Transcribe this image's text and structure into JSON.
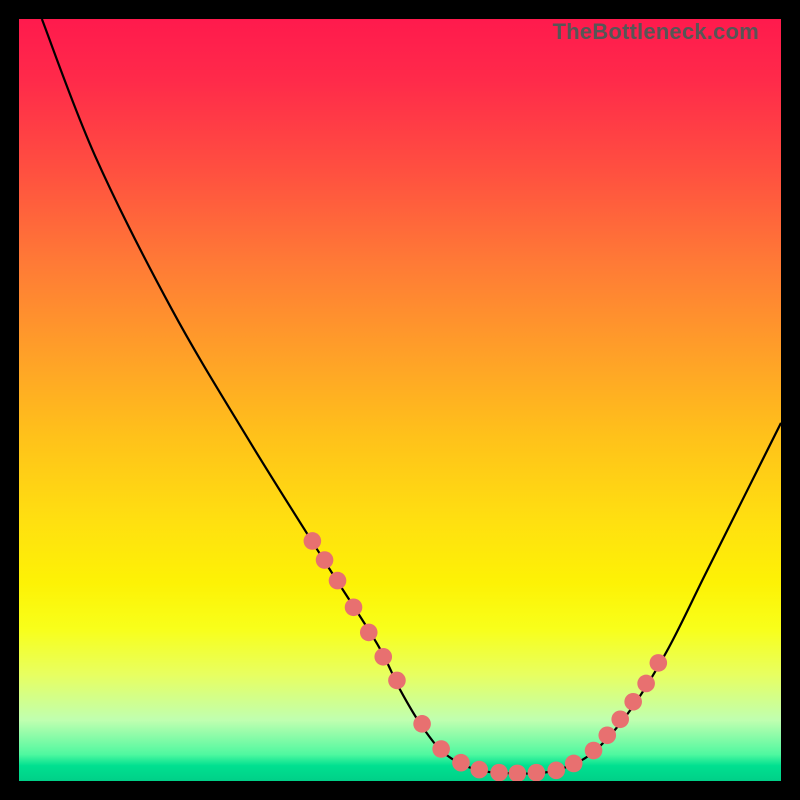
{
  "attribution": "TheBottleneck.com",
  "colors": {
    "background": "#000000",
    "gradient_top": "#ff1a4d",
    "gradient_bottom": "#00d088",
    "curve": "#000000",
    "dots": "#e87070"
  },
  "chart_data": {
    "type": "line",
    "title": "",
    "xlabel": "",
    "ylabel": "",
    "xlim": [
      0,
      100
    ],
    "ylim": [
      0,
      100
    ],
    "series": [
      {
        "name": "curve",
        "x": [
          3,
          10,
          20,
          30,
          40,
          47,
          50,
          53,
          56,
          60,
          65,
          70,
          75,
          80,
          85,
          90,
          95,
          100
        ],
        "y": [
          100,
          82,
          62,
          45,
          29,
          18,
          12,
          7,
          3.5,
          1.5,
          1,
          1.3,
          3.5,
          9,
          17,
          27,
          37,
          47
        ]
      }
    ],
    "marker_points": {
      "left_segment": {
        "x": [
          38.5,
          40.1,
          41.8,
          43.9,
          45.9,
          47.8,
          49.6
        ],
        "y": [
          31.5,
          29.0,
          26.3,
          22.8,
          19.5,
          16.3,
          13.2
        ]
      },
      "bottom_segment": {
        "x": [
          52.9,
          55.4,
          58.0,
          60.4,
          63.0,
          65.4,
          67.9,
          70.5,
          72.8
        ],
        "y": [
          7.5,
          4.2,
          2.4,
          1.5,
          1.1,
          1.0,
          1.1,
          1.4,
          2.3
        ]
      },
      "right_segment": {
        "x": [
          75.4,
          77.2,
          78.9,
          80.6,
          82.3,
          83.9
        ],
        "y": [
          4.0,
          6.0,
          8.1,
          10.4,
          12.8,
          15.5
        ]
      }
    }
  }
}
